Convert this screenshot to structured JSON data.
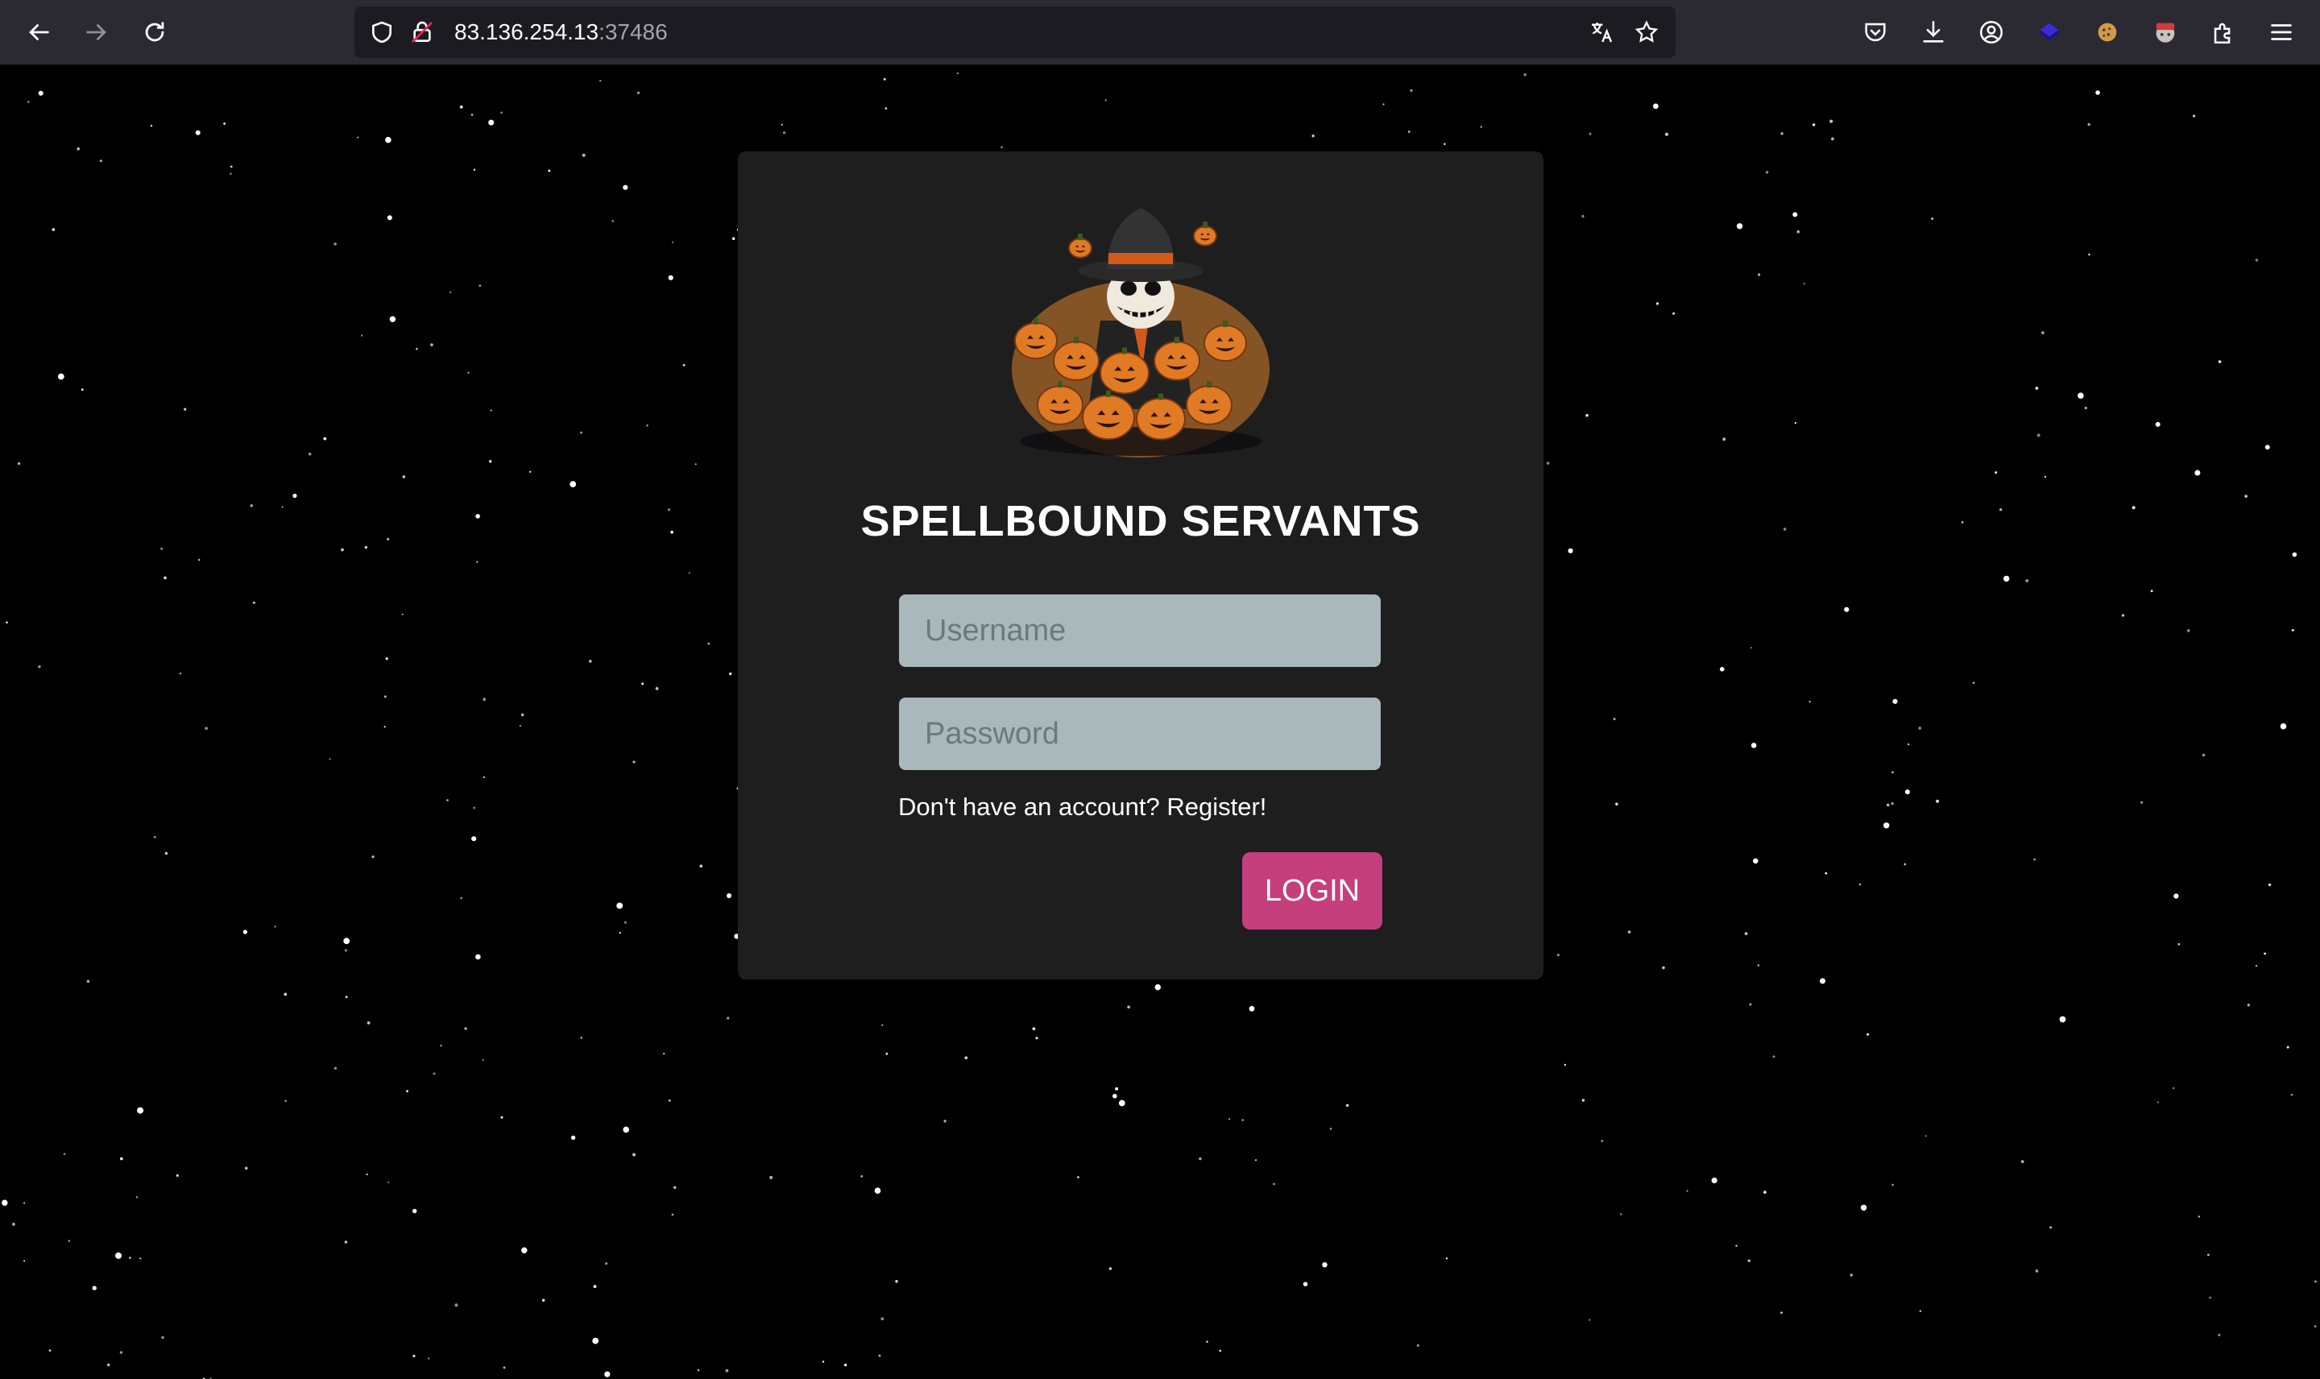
{
  "browser": {
    "url_host": "83.136.254.13",
    "url_port": ":37486",
    "icons": {
      "back": "arrow-left-icon",
      "forward": "arrow-right-icon",
      "reload": "reload-icon",
      "tracking": "shield-icon",
      "security": "lock-icon",
      "translate": "translate-icon",
      "bookmark": "star-icon",
      "pocket": "pocket-icon",
      "downloads": "download-icon",
      "account": "account-icon",
      "ext1": "extension-cube-icon",
      "ext2": "cookie-icon",
      "ext3": "extension-avatar-icon",
      "extensions": "puzzle-icon",
      "menu": "hamburger-menu-icon"
    }
  },
  "page": {
    "title": "SPELLBOUND SERVANTS",
    "username_placeholder": "Username",
    "password_placeholder": "Password",
    "register_text": "Don't have an account? Register!",
    "login_label": "LOGIN",
    "logo_icon": "pumpkin-wizard-logo",
    "colors": {
      "background": "#000000",
      "card": "#1f1e1e",
      "input": "#a9b8ba",
      "accent": "#c53f7c"
    }
  }
}
